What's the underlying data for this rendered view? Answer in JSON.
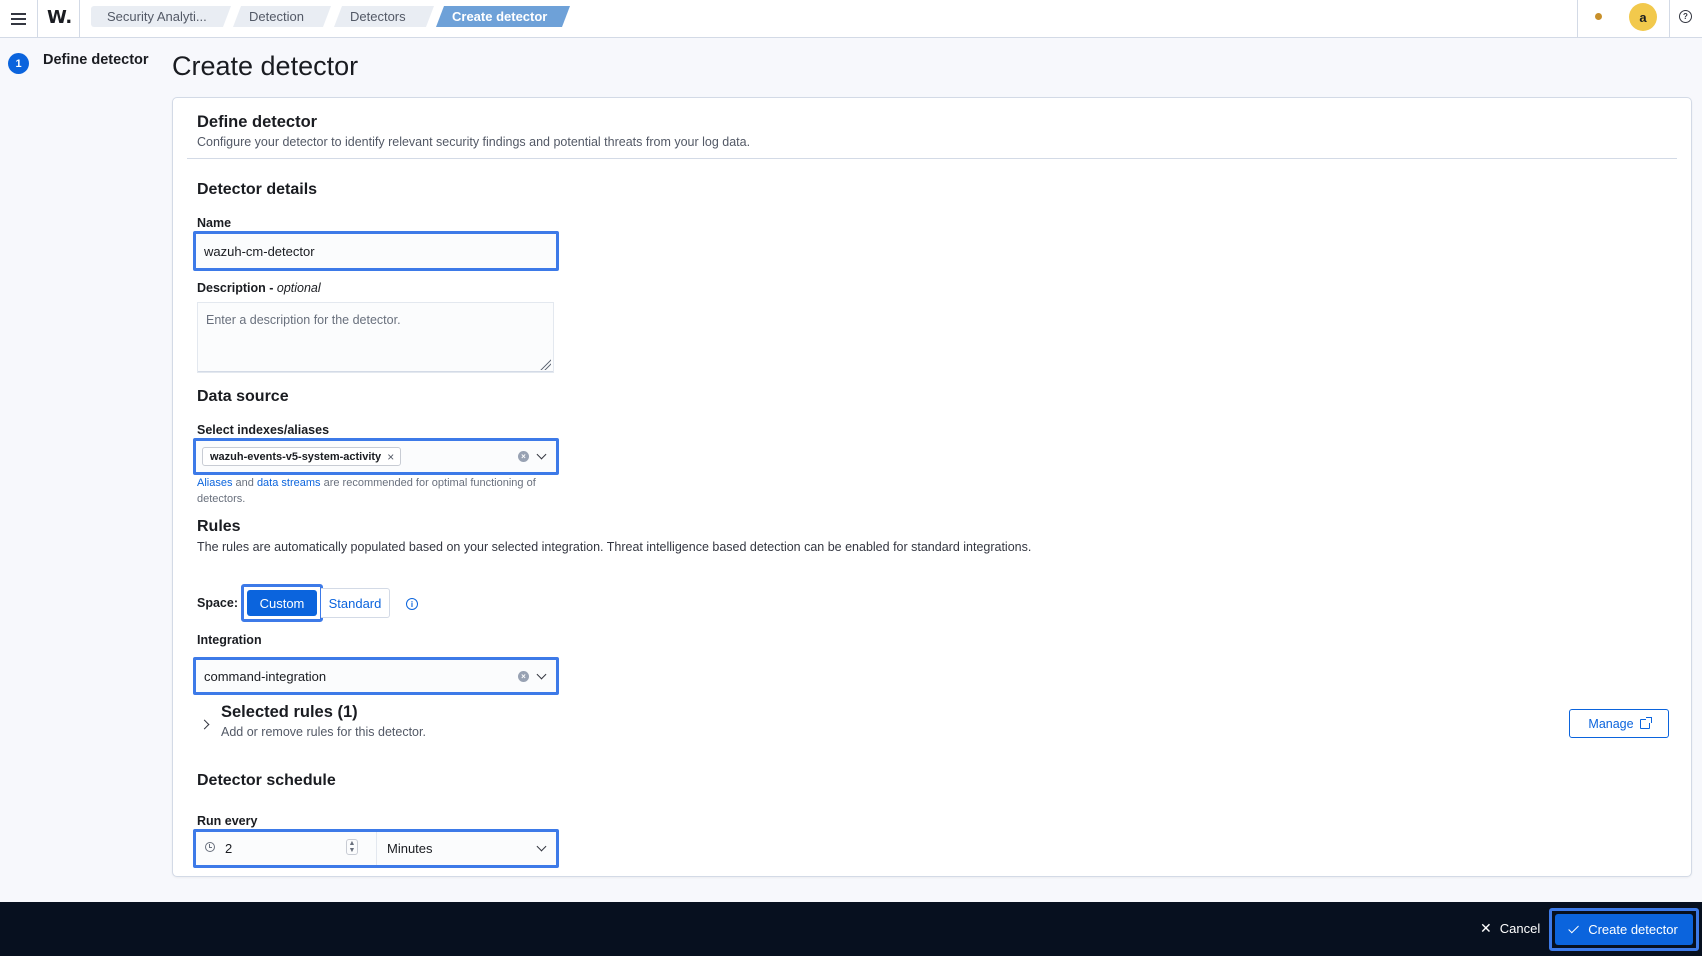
{
  "header": {
    "logo_text": "W.",
    "breadcrumbs": [
      "Security Analyti...",
      "Detection",
      "Detectors",
      "Create detector"
    ],
    "avatar_initial": "a",
    "help_glyph": "?"
  },
  "steps": {
    "step_number": "1",
    "step_label": "Define detector"
  },
  "page": {
    "title": "Create detector"
  },
  "define_section": {
    "title": "Define detector",
    "description": "Configure your detector to identify relevant security findings and potential threats from your log data."
  },
  "details_section": {
    "title": "Detector details",
    "name_label": "Name",
    "name_value": "wazuh-cm-detector",
    "description_label": "Description - ",
    "description_optional": "optional",
    "description_placeholder": "Enter a description for the detector."
  },
  "data_source": {
    "title": "Data source",
    "indexes_label": "Select indexes/aliases",
    "selected_index": "wazuh-events-v5-system-activity",
    "help_aliases": "Aliases",
    "help_and": " and ",
    "help_streams": "data streams",
    "help_rest": " are recommended for optimal functioning of detectors."
  },
  "rules": {
    "title": "Rules",
    "description": "The rules are automatically populated based on your selected integration. Threat intelligence based detection can be enabled for standard integrations.",
    "space_label": "Space:",
    "space_custom": "Custom",
    "space_standard": "Standard",
    "info_glyph": "i",
    "integration_label": "Integration",
    "integration_value": "command-integration",
    "selected_rules_title": "Selected rules (1)",
    "selected_rules_desc": "Add or remove rules for this detector.",
    "manage_label": "Manage"
  },
  "schedule": {
    "title": "Detector schedule",
    "run_every_label": "Run every",
    "interval_value": "2",
    "unit_value": "Minutes"
  },
  "footer": {
    "cancel_label": "Cancel",
    "create_label": "Create detector"
  },
  "colors": {
    "primary": "#0b64dd",
    "highlight_border": "#3d7ae8",
    "footer_bg": "#07101f",
    "avatar_bg": "#f2c94c"
  },
  "icons": [
    "menu-icon",
    "help-icon",
    "close-icon",
    "clear-icon",
    "chevron-down-icon",
    "info-icon",
    "chevron-right-icon",
    "external-link-icon",
    "clock-icon",
    "stepper-icon",
    "check-icon"
  ]
}
